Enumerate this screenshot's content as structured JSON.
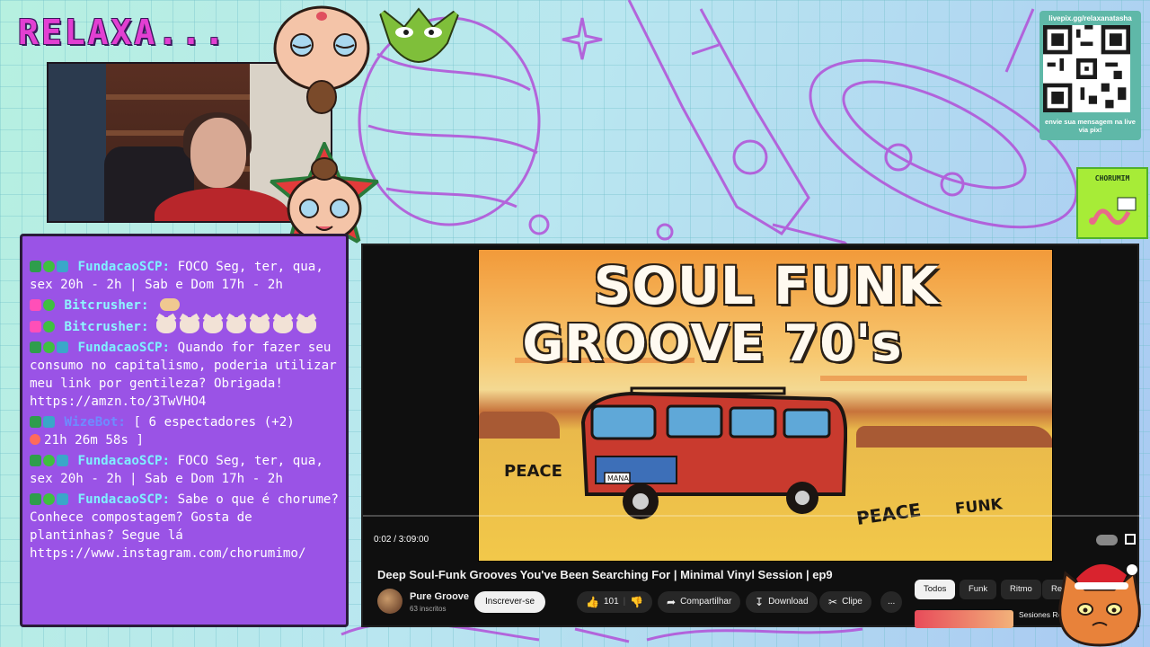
{
  "overlay": {
    "logo": "RELAXA...",
    "qr": {
      "url": "livepix.gg/relaxanatasha",
      "caption": "envie sua mensagem na live via pix!"
    },
    "sponsor_badge": "CHORUMIM"
  },
  "chat": {
    "messages": [
      {
        "badges": [
          "pencil",
          "alien",
          "bot"
        ],
        "user": "FundacaoSCP:",
        "user_color": "#7ff0ff",
        "text": "FOCO Seg, ter, qua, sex 20h - 2h | Sab e Dom 17h - 2h"
      },
      {
        "badges": [
          "heart",
          "alien"
        ],
        "user": "Bitcrusher:",
        "user_color": "#8ef6ff",
        "text": ""
      },
      {
        "badges": [
          "heart",
          "alien"
        ],
        "user": "Bitcrusher:",
        "user_color": "#8ef6ff",
        "text": ""
      },
      {
        "badges": [
          "pencil",
          "alien",
          "bot"
        ],
        "user": "FundacaoSCP:",
        "user_color": "#7ff0ff",
        "text": "Quando for fazer seu consumo no capitalismo, poderia utilizar meu link por gentileza? Obrigada! https://amzn.to/3TwVHO4"
      },
      {
        "badges": [
          "pencil",
          "bot"
        ],
        "user": "WizeBot:",
        "user_color": "#6d8cff",
        "text": "[ 6 espectadores (+2)",
        "text2": "21h 26m 58s ]"
      },
      {
        "badges": [
          "pencil",
          "alien",
          "bot"
        ],
        "user": "FundacaoSCP:",
        "user_color": "#7ff0ff",
        "text": "FOCO Seg, ter, qua, sex 20h - 2h | Sab e Dom 17h - 2h"
      },
      {
        "badges": [
          "pencil",
          "alien",
          "bot"
        ],
        "user": "FundacaoSCP:",
        "user_color": "#7ff0ff",
        "text": "Sabe o que é chorume? Conhece compostagem? Gosta de plantinhas? Segue lá https://www.instagram.com/chorumimo/"
      }
    ]
  },
  "player": {
    "thumbnail": {
      "line1": "SOUL FUNK",
      "line2": "GROOVE 70's",
      "word_peace_1": "PEACE",
      "word_peace_2": "PEACE",
      "word_funk": "FUNK",
      "plate": "MANA"
    },
    "time": "0:02 / 3:09:00",
    "progress_fraction": 0.0002,
    "title": "Deep Soul-Funk Grooves You've Been Searching For | Minimal Vinyl Session | ep9",
    "channel": {
      "name": "Pure Groove",
      "subscribers": "63 inscritos"
    },
    "subscribe_label": "Inscrever-se",
    "likes": "101",
    "share_label": "Compartilhar",
    "download_label": "Download",
    "clip_label": "Clipe",
    "more_label": "...",
    "chips": [
      "Todos",
      "Funk",
      "Ritmo",
      "Rela"
    ],
    "recommended_title": "Sesiones Remix"
  },
  "colors": {
    "accent_pink": "#e23fd2",
    "chat_bg": "#9a53e6",
    "player_bg": "#0f0f0f"
  }
}
